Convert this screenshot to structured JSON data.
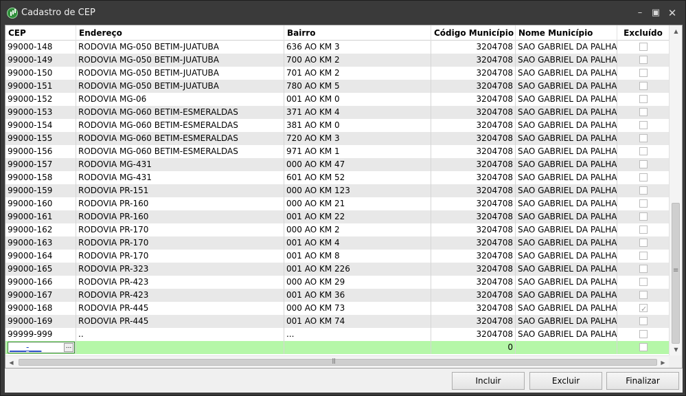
{
  "window": {
    "title": "Cadastro de CEP",
    "controls": {
      "minimize": "–",
      "maximize": "▣",
      "close": "✕"
    }
  },
  "grid": {
    "columns": [
      "CEP",
      "Endereço",
      "Bairro",
      "Código Município",
      "Nome Município",
      "Excluído"
    ],
    "rows": [
      {
        "cep": "99000-148",
        "endereco": "RODOVIA MG-050 BETIM-JUATUBA",
        "bairro": "636 AO KM 3",
        "codigo": "3204708",
        "nome": "SAO GABRIEL DA PALHA",
        "excluido": false
      },
      {
        "cep": "99000-149",
        "endereco": "RODOVIA MG-050 BETIM-JUATUBA",
        "bairro": "700 AO KM 2",
        "codigo": "3204708",
        "nome": "SAO GABRIEL DA PALHA",
        "excluido": false
      },
      {
        "cep": "99000-150",
        "endereco": "RODOVIA MG-050 BETIM-JUATUBA",
        "bairro": "701 AO KM 2",
        "codigo": "3204708",
        "nome": "SAO GABRIEL DA PALHA",
        "excluido": false
      },
      {
        "cep": "99000-151",
        "endereco": "RODOVIA MG-050 BETIM-JUATUBA",
        "bairro": "780 AO KM 5",
        "codigo": "3204708",
        "nome": "SAO GABRIEL DA PALHA",
        "excluido": false
      },
      {
        "cep": "99000-152",
        "endereco": "RODOVIA MG-06",
        "bairro": "001 AO KM 0",
        "codigo": "3204708",
        "nome": "SAO GABRIEL DA PALHA",
        "excluido": false
      },
      {
        "cep": "99000-153",
        "endereco": "RODOVIA MG-060 BETIM-ESMERALDAS",
        "bairro": "371 AO KM 4",
        "codigo": "3204708",
        "nome": "SAO GABRIEL DA PALHA",
        "excluido": false
      },
      {
        "cep": "99000-154",
        "endereco": "RODOVIA MG-060 BETIM-ESMERALDAS",
        "bairro": "381 AO KM 0",
        "codigo": "3204708",
        "nome": "SAO GABRIEL DA PALHA",
        "excluido": false
      },
      {
        "cep": "99000-155",
        "endereco": "RODOVIA MG-060 BETIM-ESMERALDAS",
        "bairro": "720 AO KM 3",
        "codigo": "3204708",
        "nome": "SAO GABRIEL DA PALHA",
        "excluido": false
      },
      {
        "cep": "99000-156",
        "endereco": "RODOVIA MG-060 BETIM-ESMERALDAS",
        "bairro": "971 AO KM 1",
        "codigo": "3204708",
        "nome": "SAO GABRIEL DA PALHA",
        "excluido": false
      },
      {
        "cep": "99000-157",
        "endereco": "RODOVIA MG-431",
        "bairro": "000 AO KM 47",
        "codigo": "3204708",
        "nome": "SAO GABRIEL DA PALHA",
        "excluido": false
      },
      {
        "cep": "99000-158",
        "endereco": "RODOVIA MG-431",
        "bairro": "601 AO KM 52",
        "codigo": "3204708",
        "nome": "SAO GABRIEL DA PALHA",
        "excluido": false
      },
      {
        "cep": "99000-159",
        "endereco": "RODOVIA PR-151",
        "bairro": "000 AO KM 123",
        "codigo": "3204708",
        "nome": "SAO GABRIEL DA PALHA",
        "excluido": false
      },
      {
        "cep": "99000-160",
        "endereco": "RODOVIA PR-160",
        "bairro": "000 AO KM 21",
        "codigo": "3204708",
        "nome": "SAO GABRIEL DA PALHA",
        "excluido": false
      },
      {
        "cep": "99000-161",
        "endereco": "RODOVIA PR-160",
        "bairro": "001 AO KM 22",
        "codigo": "3204708",
        "nome": "SAO GABRIEL DA PALHA",
        "excluido": false
      },
      {
        "cep": "99000-162",
        "endereco": "RODOVIA PR-170",
        "bairro": "000 AO KM 2",
        "codigo": "3204708",
        "nome": "SAO GABRIEL DA PALHA",
        "excluido": false
      },
      {
        "cep": "99000-163",
        "endereco": "RODOVIA PR-170",
        "bairro": "001 AO KM 4",
        "codigo": "3204708",
        "nome": "SAO GABRIEL DA PALHA",
        "excluido": false
      },
      {
        "cep": "99000-164",
        "endereco": "RODOVIA PR-170",
        "bairro": "001 AO KM 8",
        "codigo": "3204708",
        "nome": "SAO GABRIEL DA PALHA",
        "excluido": false
      },
      {
        "cep": "99000-165",
        "endereco": "RODOVIA PR-323",
        "bairro": "001 AO KM 226",
        "codigo": "3204708",
        "nome": "SAO GABRIEL DA PALHA",
        "excluido": false
      },
      {
        "cep": "99000-166",
        "endereco": "RODOVIA PR-423",
        "bairro": "000 AO KM 29",
        "codigo": "3204708",
        "nome": "SAO GABRIEL DA PALHA",
        "excluido": false
      },
      {
        "cep": "99000-167",
        "endereco": "RODOVIA PR-423",
        "bairro": "001 AO KM 36",
        "codigo": "3204708",
        "nome": "SAO GABRIEL DA PALHA",
        "excluido": false
      },
      {
        "cep": "99000-168",
        "endereco": "RODOVIA PR-445",
        "bairro": "000 AO KM 73",
        "codigo": "3204708",
        "nome": "SAO GABRIEL DA PALHA",
        "excluido": true
      },
      {
        "cep": "99000-169",
        "endereco": "RODOVIA PR-445",
        "bairro": "001 AO KM 74",
        "codigo": "3204708",
        "nome": "SAO GABRIEL DA PALHA",
        "excluido": false
      },
      {
        "cep": "99999-999",
        "endereco": "..",
        "bairro": "...",
        "codigo": "3204708",
        "nome": "SAO GABRIEL DA PALHA",
        "excluido": false
      }
    ],
    "new_row": {
      "cep_mask": "____-___",
      "ellipsis": "...",
      "codigo": "0",
      "excluido": false
    }
  },
  "buttons": {
    "incluir": "Incluir",
    "excluir": "Excluir",
    "finalizar": "Finalizar"
  },
  "colors": {
    "titlebar": "#3a3a3a",
    "row_alt": "#e8e8e8",
    "new_row": "#b5f7a8"
  }
}
